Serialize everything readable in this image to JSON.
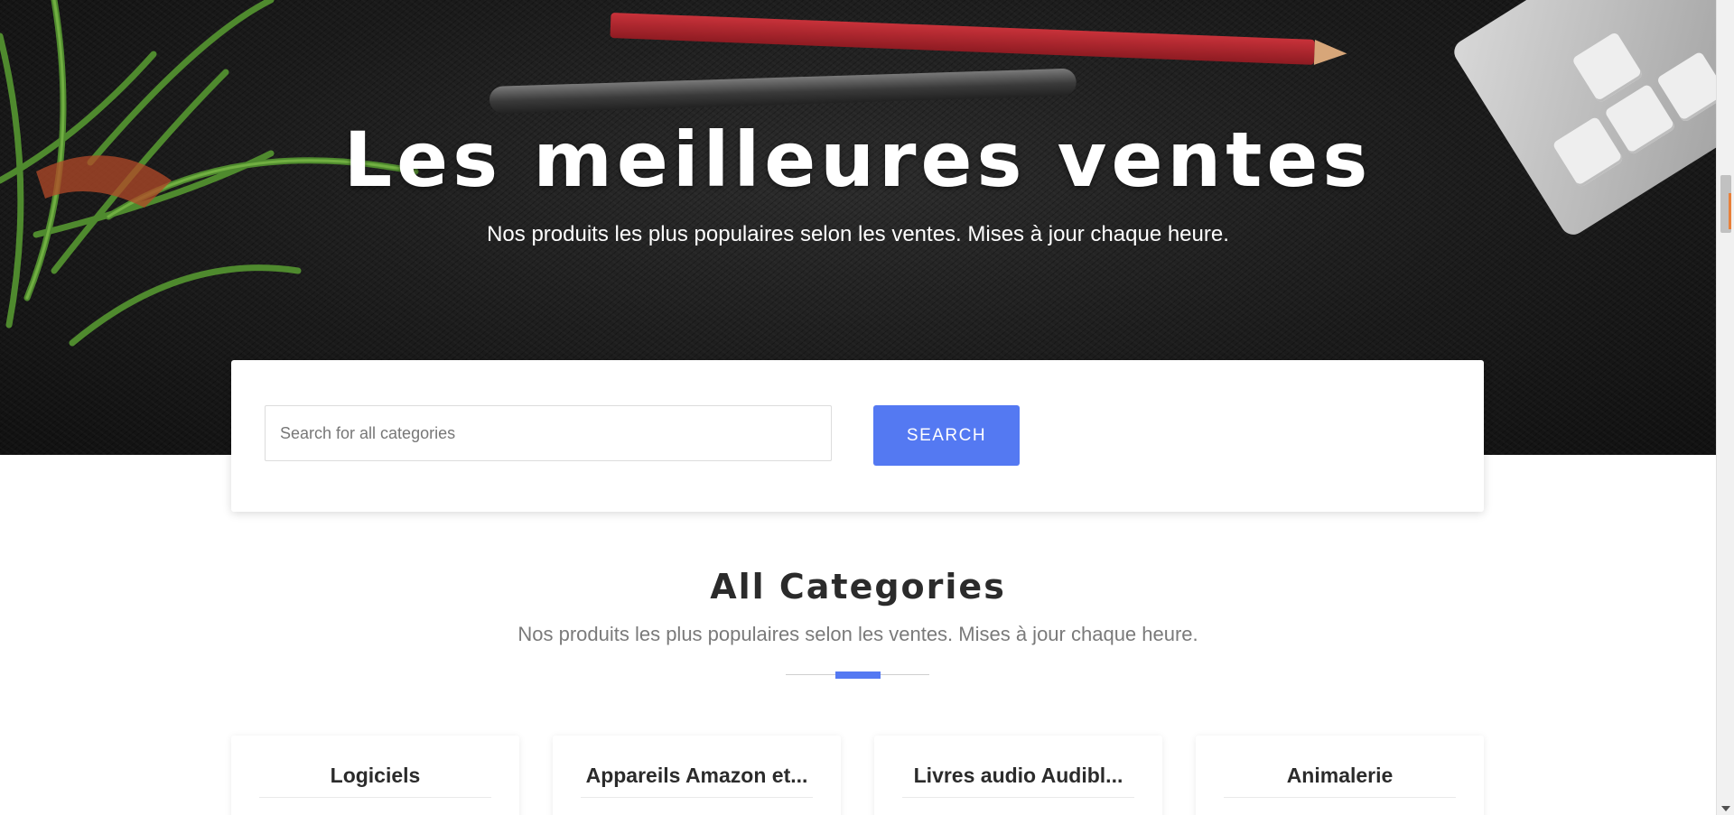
{
  "hero": {
    "title": "Les meilleures ventes",
    "subtitle": "Nos produits les plus populaires selon les ventes. Mises à jour chaque heure."
  },
  "search": {
    "placeholder": "Search for all categories",
    "button_label": "SEARCH"
  },
  "section": {
    "title": "All Categories",
    "subtitle": "Nos produits les plus populaires selon les ventes. Mises à jour chaque heure."
  },
  "categories": [
    {
      "name": "Logiciels"
    },
    {
      "name": "Appareils Amazon et..."
    },
    {
      "name": "Livres audio Audibl..."
    },
    {
      "name": "Animalerie"
    }
  ],
  "colors": {
    "accent": "#5479f2",
    "hero_background": "#1b1b1b",
    "text_dark": "#2b2b2b",
    "text_muted": "#7a7a7a"
  }
}
